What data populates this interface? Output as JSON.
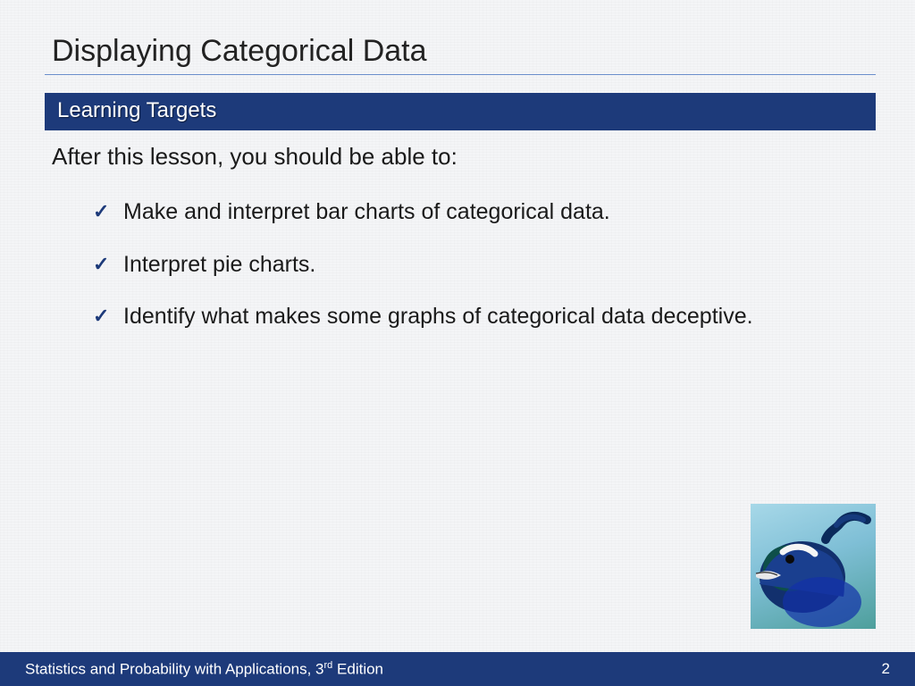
{
  "title": "Displaying Categorical Data",
  "subhead": "Learning Targets",
  "intro": "After this lesson, you should be able to:",
  "targets": [
    "Make and interpret bar charts of categorical data.",
    "Interpret pie charts.",
    "Identify what makes some graphs of categorical data deceptive."
  ],
  "footer": {
    "book_prefix": "Statistics and Probability with Applications, 3",
    "book_ord": "rd",
    "book_suffix": " Edition",
    "page": "2"
  },
  "image": {
    "alt": "peacock head"
  }
}
